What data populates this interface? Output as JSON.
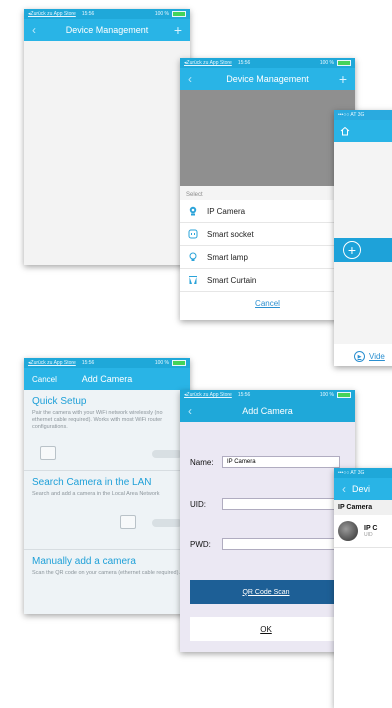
{
  "colors": {
    "nav": "#29b4e6",
    "status": "#1fa8d9",
    "accent": "#1fa0d8",
    "qr_button": "#1d5f96"
  },
  "status_bar": {
    "back_link": "◂Zurück zu App Store",
    "time": "15:56",
    "battery": "100 %",
    "carrier": "•••○○ AT 3G"
  },
  "device_management": {
    "title": "Device Management",
    "back_icon": "chevron-left-icon",
    "add_icon": "plus-icon"
  },
  "select_sheet": {
    "label": "Select",
    "options": [
      {
        "label": "IP Camera",
        "icon": "camera-icon"
      },
      {
        "label": "Smart socket",
        "icon": "socket-icon"
      },
      {
        "label": "Smart lamp",
        "icon": "lamp-icon"
      },
      {
        "label": "Smart Curtain",
        "icon": "curtain-icon"
      }
    ],
    "cancel": "Cancel"
  },
  "home_screen": {
    "video_label": "Vide",
    "home_icon": "home-icon",
    "add_icon": "plus-circle-icon"
  },
  "add_camera": {
    "title": "Add Camera",
    "cancel": "Cancel",
    "sections": [
      {
        "title": "Quick Setup",
        "desc": "Pair the camera with your WiFi network wirelessly (no ethernet cable required). Works with most WiFi router configurations."
      },
      {
        "title": "Search Camera in the LAN",
        "desc": "Search and add a camera in the Local Area Network"
      },
      {
        "title": "Manually add a camera",
        "desc": "Scan the QR code on your camera (ethernet cable required)."
      }
    ]
  },
  "add_camera_form": {
    "title": "Add Camera",
    "name_label": "Name:",
    "name_value": "IP Camera",
    "uid_label": "UID:",
    "uid_value": "",
    "pwd_label": "PWD:",
    "pwd_value": "",
    "qr_button": "QR Code Scan",
    "ok_button": "OK"
  },
  "device_list": {
    "title": "Devi",
    "section": "IP Camera",
    "item_name": "IP C",
    "item_sub": "UID"
  }
}
